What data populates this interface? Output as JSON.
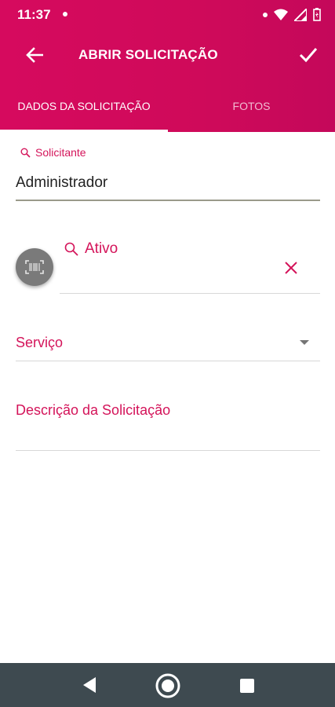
{
  "status_bar": {
    "time": "11:37"
  },
  "app_bar": {
    "title": "ABRIR SOLICITAÇÃO"
  },
  "tabs": [
    {
      "label": "DADOS DA SOLICITAÇÃO",
      "active": true
    },
    {
      "label": "FOTOS",
      "active": false
    }
  ],
  "form": {
    "solicitante": {
      "label": "Solicitante",
      "value": "Administrador"
    },
    "ativo": {
      "label": "Ativo"
    },
    "servico": {
      "label": "Serviço"
    },
    "descricao": {
      "label": "Descrição da Solicitação"
    }
  },
  "colors": {
    "primary": "#d60a5e",
    "accent_text": "#d4145a",
    "nav_bar": "#3e4a50"
  },
  "icons": [
    "arrow-back-icon",
    "check-icon",
    "search-icon",
    "barcode-icon",
    "close-icon",
    "dropdown-arrow-icon",
    "nav-back-icon",
    "nav-home-icon",
    "nav-recents-icon",
    "wifi-icon",
    "signal-icon",
    "battery-icon"
  ]
}
